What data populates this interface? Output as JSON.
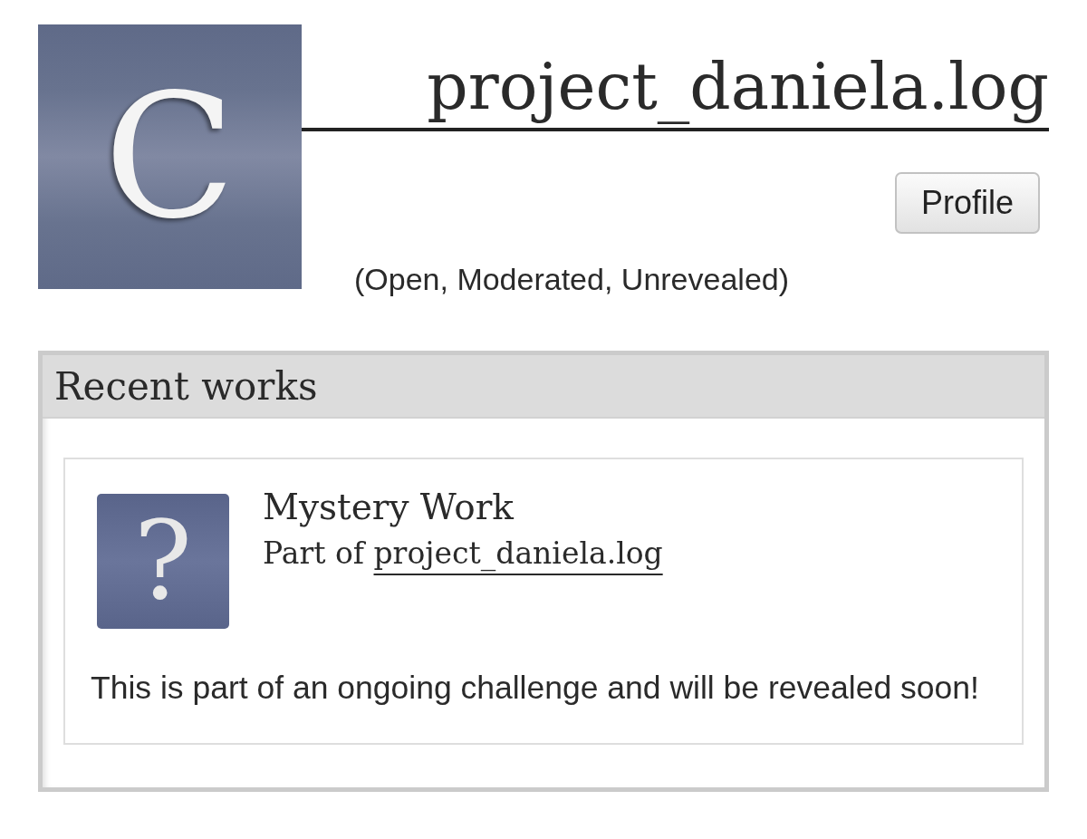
{
  "collection": {
    "icon_letter": "C",
    "title": "project_daniela.log",
    "buttons": [
      "Profile"
    ],
    "status": "(Open, Moderated, Unrevealed)"
  },
  "recent_works": {
    "heading": "Recent works",
    "works": [
      {
        "thumbnail_symbol": "?",
        "title": "Mystery Work",
        "part_of": {
          "prefix": "Part of",
          "link": "project_daniela.log"
        },
        "summary": "This is part of an ongoing challenge and will be revealed soon!"
      }
    ]
  }
}
